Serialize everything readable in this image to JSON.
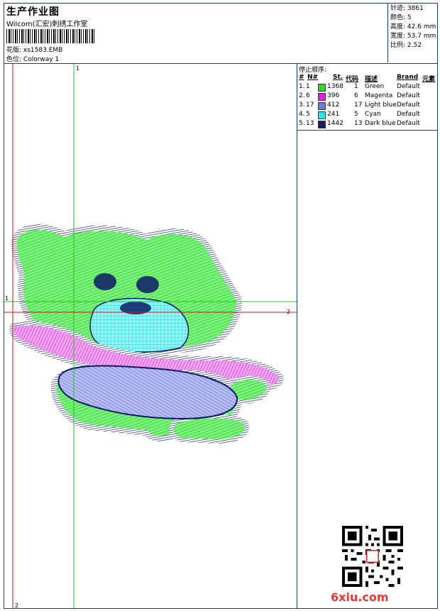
{
  "header": {
    "title": "生产作业图",
    "subtitle": "Wilcom(汇宏)刺绣工作室",
    "design_label": "花版:",
    "design_value": "xs1583.EMB",
    "colorway_label": "色位:",
    "colorway_value": "Colorway 1"
  },
  "stats": [
    {
      "label": "针迹:",
      "value": "3861"
    },
    {
      "label": "颜色:",
      "value": "5"
    },
    {
      "label": "高度:",
      "value": "42.6 mm"
    },
    {
      "label": "宽度:",
      "value": "53.7 mm"
    },
    {
      "label": "比例:",
      "value": "2.52"
    }
  ],
  "stop_sequence": {
    "title": "停止顺序:",
    "columns": [
      "#",
      "N#",
      "St.",
      "代码",
      "描述",
      "Brand",
      "元素"
    ],
    "rows": [
      {
        "index": "1.",
        "n": "1",
        "st": "1368",
        "code": "1",
        "desc": "Green",
        "brand": "Default",
        "color": "#22e022"
      },
      {
        "index": "2.",
        "n": "6",
        "st": "396",
        "code": "6",
        "desc": "Magenta",
        "brand": "Default",
        "color": "#e022e0"
      },
      {
        "index": "3.",
        "n": "17",
        "st": "412",
        "code": "17",
        "desc": "Light blue",
        "brand": "Default",
        "color": "#6a78e0"
      },
      {
        "index": "4.",
        "n": "5",
        "st": "241",
        "code": "5",
        "desc": "Cyan",
        "brand": "Default",
        "color": "#22e8e8"
      },
      {
        "index": "5.",
        "n": "13",
        "st": "1442",
        "code": "13",
        "desc": "Dark blue",
        "brand": "Default",
        "color": "#10206a"
      }
    ]
  },
  "guides": {
    "v_top": "1",
    "v_bottom": "2",
    "h_left": "1",
    "h_right": "2"
  },
  "watermark": "6xiu.com",
  "colors": {
    "border": "#1f3a8a",
    "guide_green": "#22c822",
    "guide_red": "#e01010"
  }
}
